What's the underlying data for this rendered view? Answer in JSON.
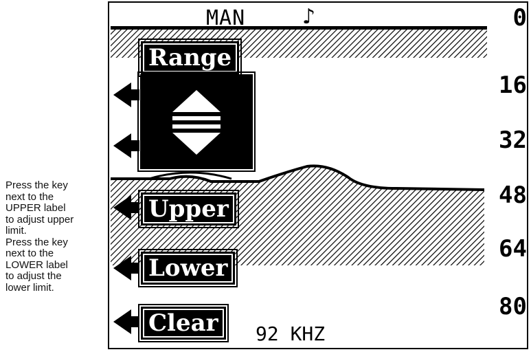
{
  "side_note": {
    "lines": [
      "Press the key",
      "next to the",
      "UPPER label",
      "to adjust upper",
      "limit.",
      "Press the key",
      "next to the",
      "LOWER label",
      "to adjust the",
      "lower limit."
    ]
  },
  "header": {
    "mode": "MAN",
    "mode_icon": "music-note-icon"
  },
  "depth_scale": [
    "0",
    "16",
    "32",
    "48",
    "64",
    "80"
  ],
  "menu": {
    "range": "Range",
    "upper": "Upper",
    "lower": "Lower",
    "clear": "Clear"
  },
  "frequency": "92 KHZ",
  "colors": {
    "foreground": "#000000",
    "background": "#ffffff"
  }
}
